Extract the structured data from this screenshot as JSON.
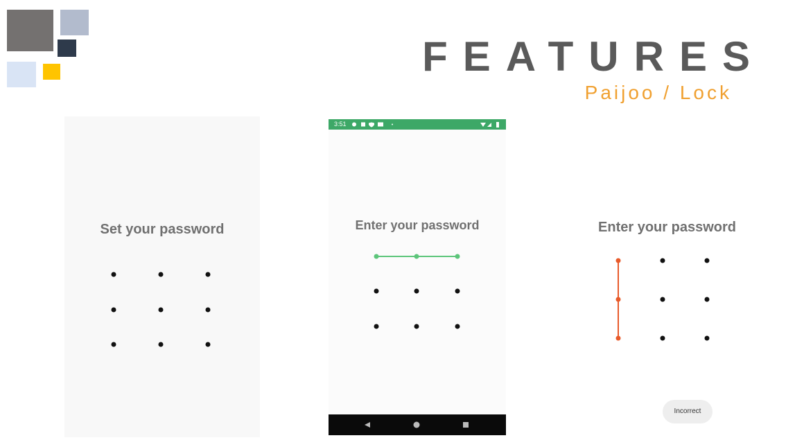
{
  "header": {
    "title": "FEATURES",
    "subtitle": "Paijoo / Lock"
  },
  "screens": [
    {
      "heading": "Set your password",
      "pattern": "none"
    },
    {
      "status": {
        "time": "3:51"
      },
      "heading": "Enter your password",
      "pattern": "top row connected",
      "pattern_color": "#5cc57a",
      "nav_icons": [
        "back-icon",
        "home-icon",
        "recents-icon"
      ]
    },
    {
      "heading": "Enter your password",
      "pattern": "left column connected",
      "pattern_color": "#e85a2a",
      "toast": "Incorrect"
    }
  ],
  "colors": {
    "title": "#5a5a5a",
    "subtitle": "#f0a030",
    "status_bar": "#3da867",
    "nav_bar": "#0a0a0a",
    "deco": [
      "#747170",
      "#b2bbcd",
      "#2e3a4b",
      "#d9e4f5",
      "#ffc400"
    ]
  }
}
